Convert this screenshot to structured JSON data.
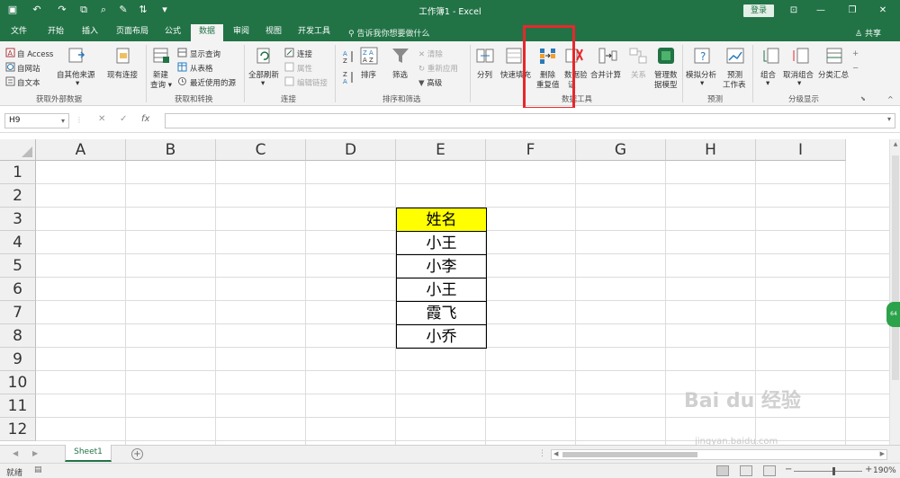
{
  "titlebar": {
    "title": "工作簿1 - Excel",
    "login": "登录"
  },
  "tabs": [
    "文件",
    "开始",
    "插入",
    "页面布局",
    "公式",
    "数据",
    "审阅",
    "视图",
    "开发工具"
  ],
  "active_tab": "数据",
  "tellme": "告诉我你想要做什么",
  "share": "共享",
  "ribbon": {
    "get_external": {
      "label": "获取外部数据",
      "access": "自 Access",
      "web": "自网站",
      "text": "自文本",
      "other": "自其他来源",
      "existing": "现有连接"
    },
    "get_transform": {
      "label": "获取和转换",
      "new_query": "新建",
      "new_query2": "查询",
      "show_queries": "显示查询",
      "from_table": "从表格",
      "recent": "最近使用的源"
    },
    "connections": {
      "label": "连接",
      "refresh_all": "全部刷新",
      "connections": "连接",
      "properties": "属性",
      "edit_links": "编辑链接"
    },
    "sort_filter": {
      "label": "排序和筛选",
      "sort": "排序",
      "filter": "筛选",
      "clear": "清除",
      "reapply": "重新应用",
      "advanced": "高级"
    },
    "data_tools": {
      "label": "数据工具",
      "text_to_columns": "分列",
      "flash_fill": "快速填充",
      "remove_dup": "删除",
      "remove_dup2": "重复值",
      "validation": "数据验",
      "validation2": "证",
      "consolidate": "合并计算",
      "relationships": "关系",
      "manage_model": "管理数",
      "manage_model2": "据模型"
    },
    "forecast": {
      "label": "预测",
      "what_if": "模拟分析",
      "forecast_sheet": "预测",
      "forecast_sheet2": "工作表"
    },
    "outline": {
      "label": "分级显示",
      "group": "组合",
      "ungroup": "取消组合",
      "subtotal": "分类汇总"
    }
  },
  "formula_bar": {
    "name_box": "H9",
    "fx": "fx",
    "content": ""
  },
  "columns": [
    "A",
    "B",
    "C",
    "D",
    "E",
    "F",
    "G",
    "H",
    "I"
  ],
  "rows": [
    "1",
    "2",
    "3",
    "4",
    "5",
    "6",
    "7",
    "8",
    "9",
    "10",
    "11",
    "12"
  ],
  "table": {
    "header": "姓名",
    "header_bg": "#ffff00",
    "values": [
      "小王",
      "小李",
      "小王",
      "霞飞",
      "小乔"
    ]
  },
  "sheets": [
    "Sheet1"
  ],
  "status": {
    "ready": "就绪",
    "zoom": "190%"
  },
  "side_badge": "64",
  "watermark": {
    "brand": "Bai du 经验",
    "url": "jingyan.baidu.com"
  },
  "colors": {
    "excel_green": "#217346",
    "highlight_red": "#e8272c"
  }
}
